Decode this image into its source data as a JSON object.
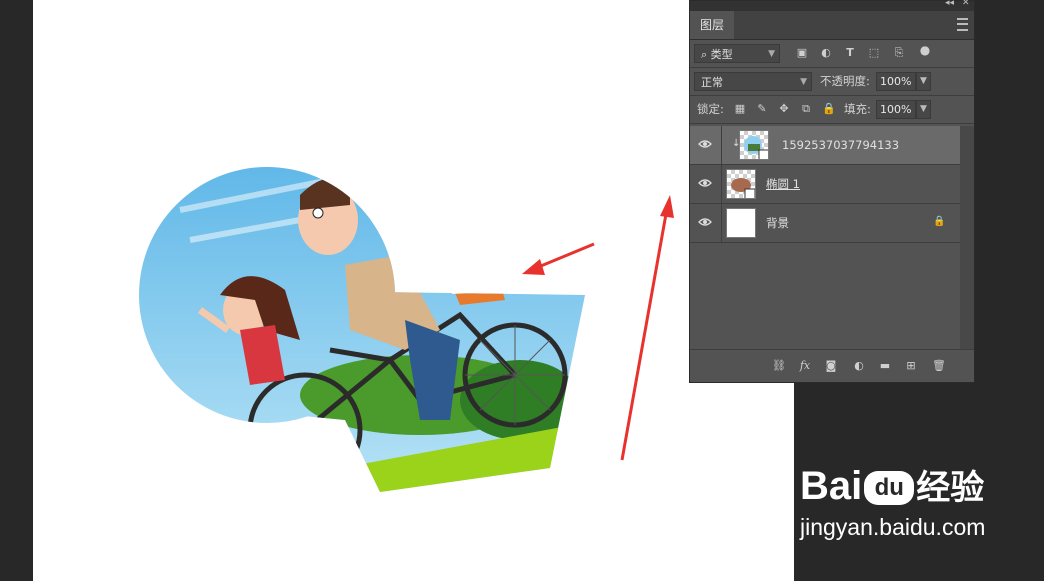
{
  "panel": {
    "tab_label": "图层",
    "filter": {
      "label": "类型"
    },
    "blend_mode": "正常",
    "opacity_label": "不透明度:",
    "opacity_value": "100%",
    "lock_label": "锁定:",
    "fill_label": "填充:",
    "fill_value": "100%",
    "layers": [
      {
        "name": "1592537037794133",
        "selected": true,
        "type": "smart-object-clipped"
      },
      {
        "name": "椭圆 1",
        "selected": false,
        "type": "shape"
      },
      {
        "name": "背景",
        "selected": false,
        "type": "background",
        "locked": true
      }
    ]
  },
  "watermark": {
    "brand_text": "Bai",
    "brand_suffix": "经验",
    "logo_text": "du",
    "url": "jingyan.baidu.com"
  },
  "colors": {
    "canvas": "#ffffff",
    "workspace": "#282828",
    "panel": "#535353",
    "arrow": "#e8322e",
    "sky": "#8fd0f0",
    "grass": "#9bd21a"
  }
}
